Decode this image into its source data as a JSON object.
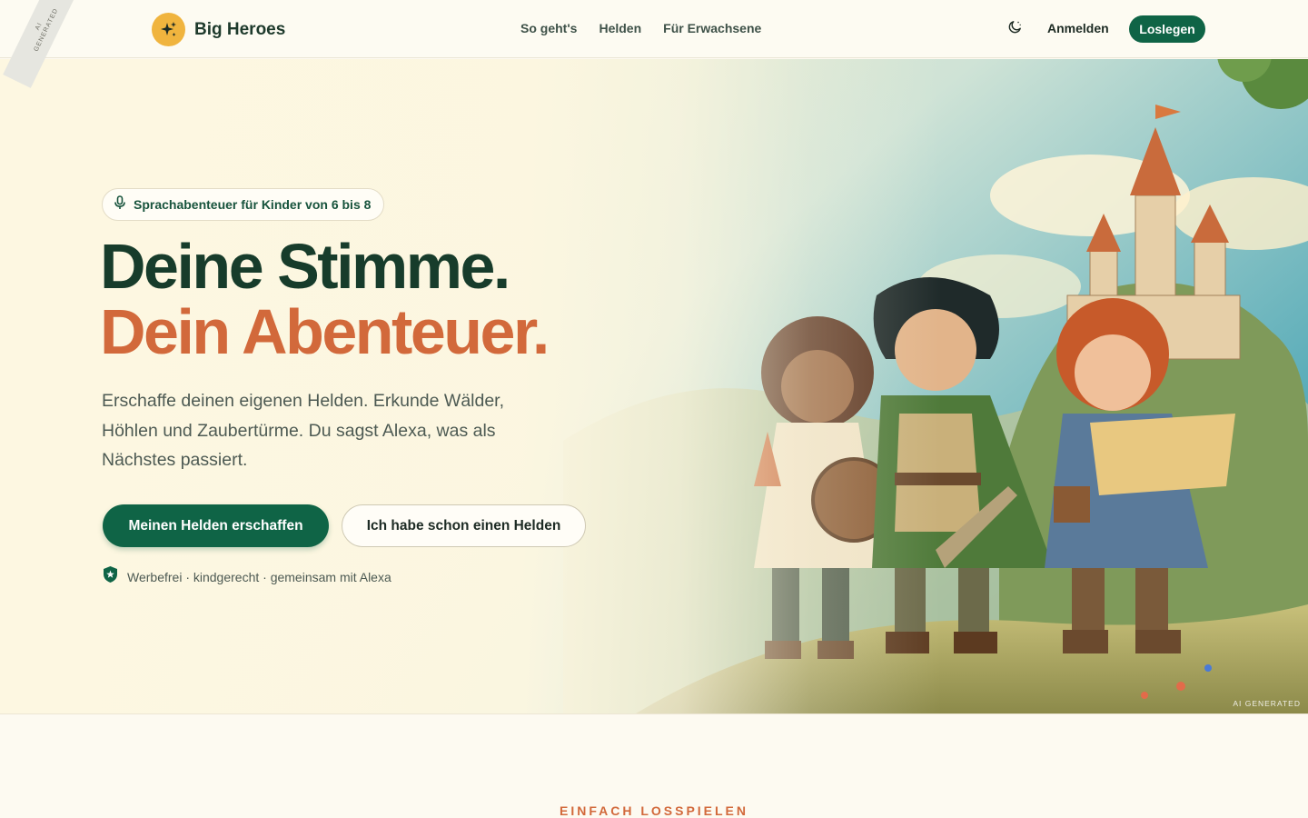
{
  "header": {
    "ai_ribbon": "AI GENERATED",
    "brand_name": "Big Heroes",
    "nav": [
      "So geht's",
      "Helden",
      "Für Erwachsene"
    ],
    "login_label": "Anmelden",
    "start_label": "Loslegen"
  },
  "hero": {
    "badge": "Sprachabenteuer für Kinder von 6 bis 8",
    "title_line1": "Deine Stimme.",
    "title_line2": "Dein Abenteuer.",
    "description": "Erschaffe deinen eigenen Helden. Erkunde Wälder, Höhlen und Zaubertürme. Du sagst Alexa, was als Nächstes passiert.",
    "primary_cta": "Meinen Helden erschaffen",
    "secondary_cta": "Ich habe schon einen Helden",
    "trust_text": "Werbefrei · kindgerecht · gemeinsam mit Alexa",
    "ai_label": "AI GENERATED"
  },
  "next_section": {
    "eyebrow": "EINFACH LOSSPIELEN"
  },
  "colors": {
    "brand_green": "#0f6446",
    "title_dark": "#173c2b",
    "accent_orange": "#d2693b",
    "logo_yellow": "#f0b43e",
    "background": "#fdfaf1"
  },
  "icons": {
    "brand_logo": "sparkle-icon",
    "theme_toggle": "moon-icon",
    "badge": "microphone-icon",
    "trust": "shield-star-icon"
  }
}
